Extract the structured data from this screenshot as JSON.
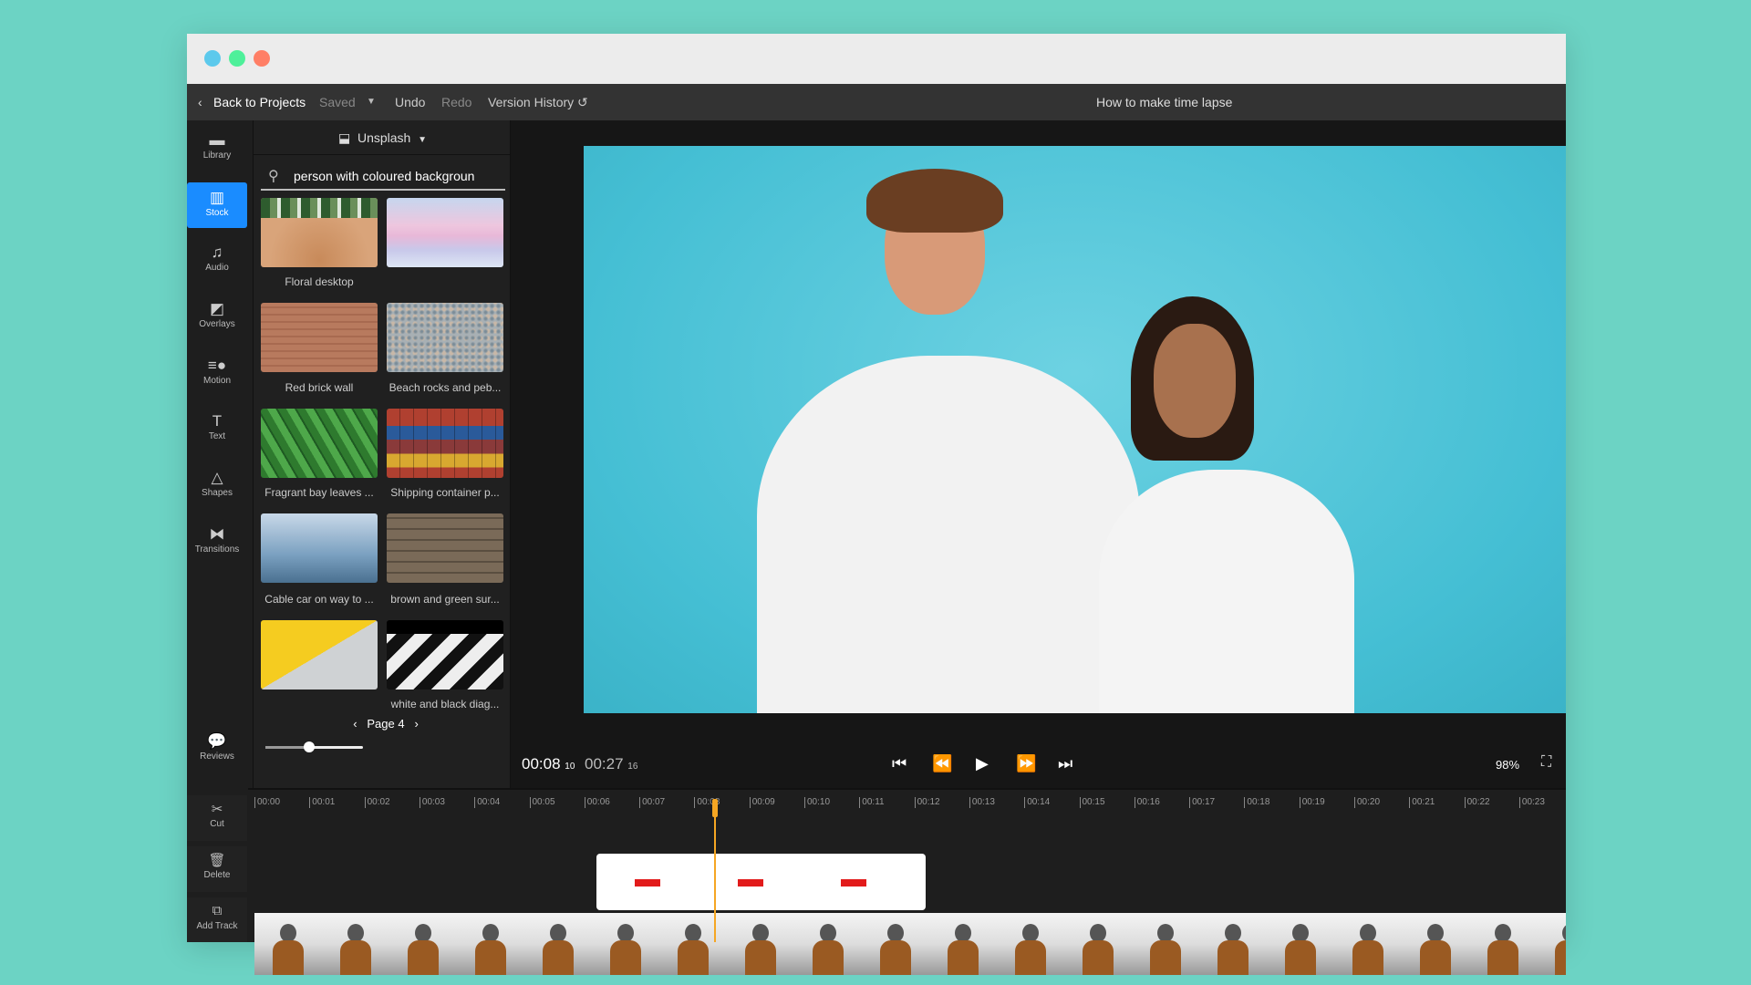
{
  "window": {
    "lights": [
      "#5cc9ec",
      "#4ef09a",
      "#ff7f66"
    ]
  },
  "header": {
    "back": "Back to Projects",
    "saved": "Saved",
    "undo": "Undo",
    "redo": "Redo",
    "version_history": "Version History",
    "project_title": "How to make time lapse"
  },
  "sidebar": {
    "items": [
      {
        "label": "Library",
        "icon": "folder-icon"
      },
      {
        "label": "Stock",
        "icon": "stock-icon",
        "active": true
      },
      {
        "label": "Audio",
        "icon": "music-note-icon"
      },
      {
        "label": "Overlays",
        "icon": "overlay-icon"
      },
      {
        "label": "Motion",
        "icon": "motion-icon"
      },
      {
        "label": "Text",
        "icon": "text-icon"
      },
      {
        "label": "Shapes",
        "icon": "shapes-icon"
      },
      {
        "label": "Transitions",
        "icon": "transitions-icon"
      }
    ],
    "reviews": "Reviews"
  },
  "panel": {
    "source": "Unsplash",
    "search_value": "person with coloured backgroun",
    "page": "Page 4",
    "zoom_slider": 0.45,
    "items": [
      {
        "label": "Floral desktop"
      },
      {
        "label": ""
      },
      {
        "label": "Red brick wall"
      },
      {
        "label": "Beach rocks and peb..."
      },
      {
        "label": "Fragrant bay leaves ..."
      },
      {
        "label": "Shipping container p..."
      },
      {
        "label": "Cable car on way to ..."
      },
      {
        "label": "brown and green sur..."
      },
      {
        "label": ""
      },
      {
        "label": "white and black diag..."
      }
    ]
  },
  "player": {
    "current": "00:08",
    "current_frames": "10",
    "total": "00:27",
    "total_frames": "16",
    "zoom": "98%"
  },
  "timeline": {
    "ticks": [
      "00:00",
      "00:01",
      "00:02",
      "00:03",
      "00:04",
      "00:05",
      "00:06",
      "00:07",
      "00:08",
      "00:09",
      "00:10",
      "00:11",
      "00:12",
      "00:13",
      "00:14",
      "00:15",
      "00:16",
      "00:17",
      "00:18",
      "00:19",
      "00:20",
      "00:21",
      "00:22",
      "00:23"
    ],
    "tools": [
      {
        "label": "Cut",
        "icon": "scissors-icon"
      },
      {
        "label": "Delete",
        "icon": "trash-icon"
      },
      {
        "label": "Add Track",
        "icon": "add-track-icon"
      }
    ],
    "playhead_color": "#f5a623"
  }
}
